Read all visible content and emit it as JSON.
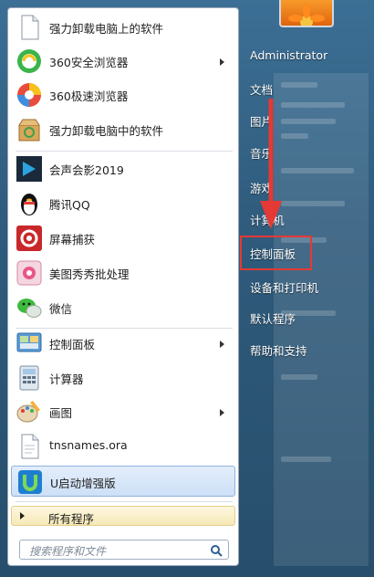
{
  "left_items": [
    {
      "label": "强力卸载电脑上的软件",
      "icon": "document-icon",
      "has_arrow": false
    },
    {
      "label": "360安全浏览器",
      "icon": "360-browser-icon",
      "has_arrow": true
    },
    {
      "label": "360极速浏览器",
      "icon": "360-speed-browser-icon",
      "has_arrow": false
    },
    {
      "label": "强力卸载电脑中的软件",
      "icon": "uninstall-box-icon",
      "has_arrow": false
    },
    {
      "label": "会声会影2019",
      "icon": "video-editor-icon",
      "has_arrow": false
    },
    {
      "label": "腾讯QQ",
      "icon": "qq-penguin-icon",
      "has_arrow": false
    },
    {
      "label": "屏幕捕获",
      "icon": "screen-capture-icon",
      "has_arrow": false
    },
    {
      "label": "美图秀秀批处理",
      "icon": "meitu-icon",
      "has_arrow": false
    },
    {
      "label": "微信",
      "icon": "wechat-icon",
      "has_arrow": false
    },
    {
      "label": "控制面板",
      "icon": "control-panel-icon",
      "has_arrow": true
    },
    {
      "label": "计算器",
      "icon": "calculator-icon",
      "has_arrow": false
    },
    {
      "label": "画图",
      "icon": "paint-palette-icon",
      "has_arrow": true
    },
    {
      "label": "tnsnames.ora",
      "icon": "file-icon",
      "has_arrow": false
    },
    {
      "label": "U启动增强版",
      "icon": "u-boot-icon",
      "has_arrow": false
    }
  ],
  "all_programs": "所有程序",
  "search_placeholder": "搜索程序和文件",
  "right_items": [
    "Administrator",
    "文档",
    "图片",
    "音乐",
    "游戏",
    "计算机",
    "控制面板",
    "设备和打印机",
    "默认程序",
    "帮助和支持"
  ],
  "highlight_color": "#e53935"
}
